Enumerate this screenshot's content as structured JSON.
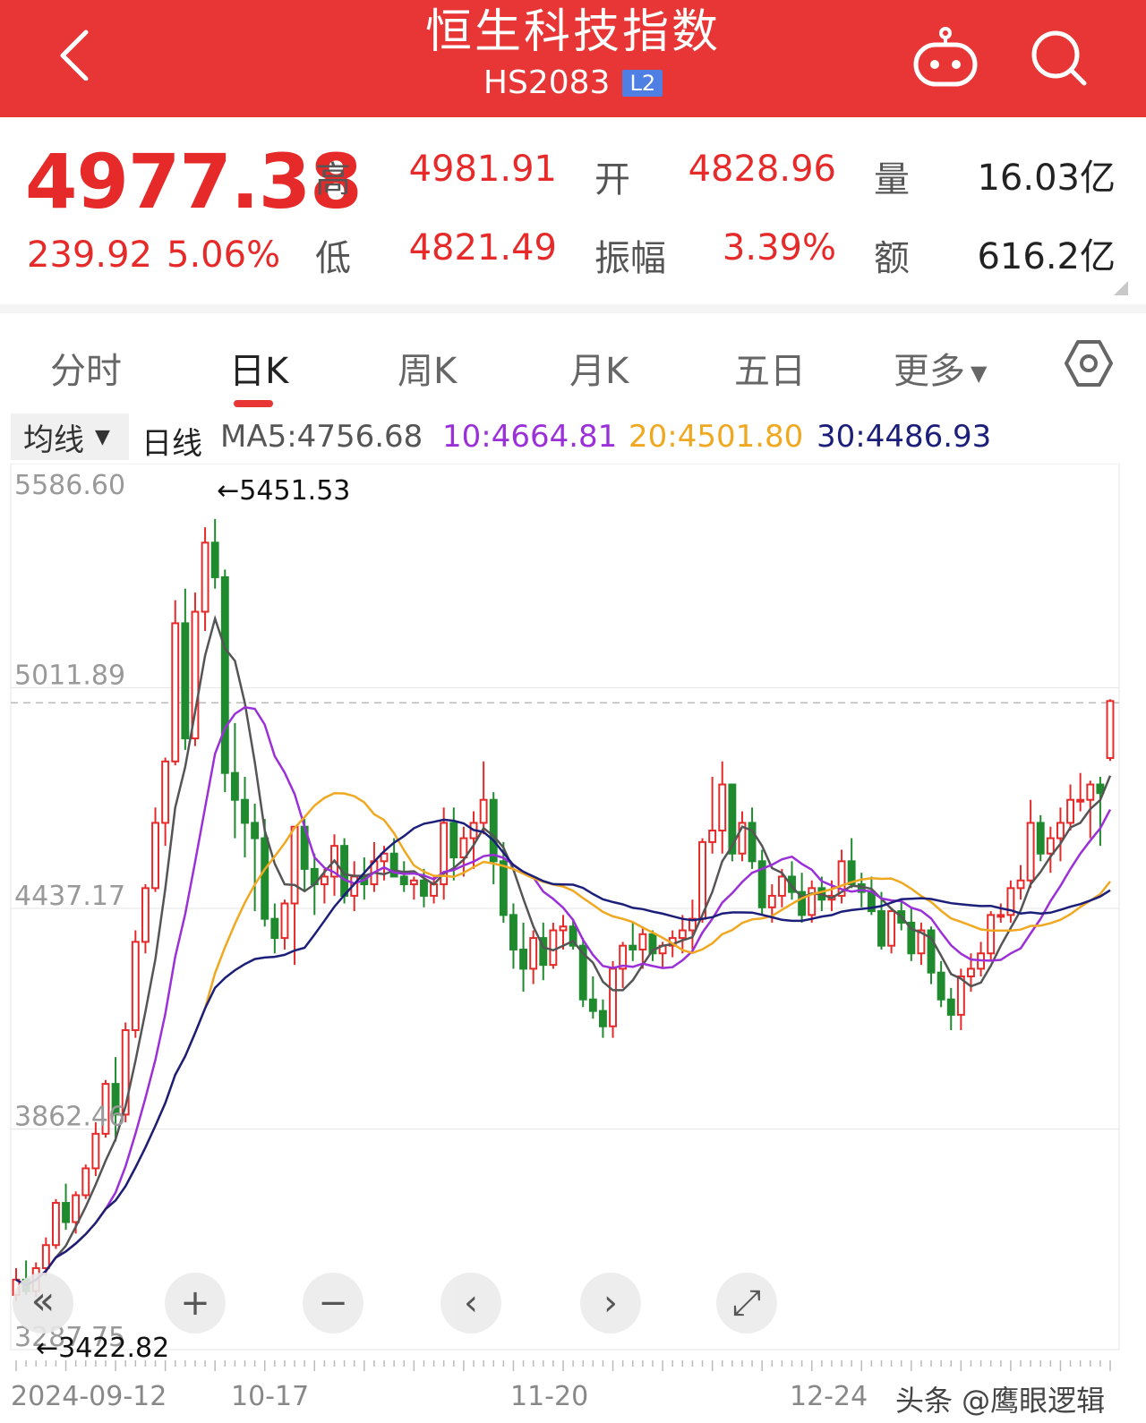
{
  "header": {
    "title": "恒生科技指数",
    "code": "HS2083",
    "level_badge": "L2"
  },
  "quote": {
    "price": "4977.38",
    "change": "239.92",
    "change_pct": "5.06%",
    "high_label": "高",
    "high": "4981.91",
    "open_label": "开",
    "open": "4828.96",
    "volume_label": "量",
    "volume": "16.03亿",
    "low_label": "低",
    "low": "4821.49",
    "amplitude_label": "振幅",
    "amplitude": "3.39%",
    "amount_label": "额",
    "amount": "616.2亿"
  },
  "tabs": [
    "分时",
    "日K",
    "周K",
    "月K",
    "五日",
    "更多"
  ],
  "active_tab": "日K",
  "ma_bar": {
    "selector": "均线",
    "period": "日线",
    "ma5": "MA5:4756.68",
    "ma10": "10:4664.81",
    "ma20": "20:4501.80",
    "ma30": "30:4486.93"
  },
  "colors": {
    "brand_red": "#e83535",
    "up": "#e62a2a",
    "down": "#1f8a2e",
    "ma5": "#555555",
    "ma10": "#9b30d9",
    "ma20": "#f0a820",
    "ma30": "#1c1f7a"
  },
  "chart_data": {
    "type": "candlestick",
    "y_tick_labels": [
      "5586.60",
      "5011.89",
      "4437.17",
      "3862.46",
      "3287.75"
    ],
    "x_tick_labels": [
      "2024-09-12",
      "10-17",
      "11-20",
      "12-24"
    ],
    "max_marker": "←5451.53",
    "min_marker": "←3422.82",
    "ylim": [
      3287.75,
      5586.6
    ],
    "last_close": 4977.38,
    "candles": [
      [
        3430,
        3500,
        3415,
        3470
      ],
      [
        3470,
        3520,
        3430,
        3440
      ],
      [
        3440,
        3515,
        3425,
        3500
      ],
      [
        3500,
        3580,
        3480,
        3560
      ],
      [
        3560,
        3680,
        3550,
        3670
      ],
      [
        3670,
        3720,
        3600,
        3620
      ],
      [
        3620,
        3700,
        3590,
        3690
      ],
      [
        3690,
        3770,
        3680,
        3760
      ],
      [
        3760,
        3880,
        3740,
        3850
      ],
      [
        3850,
        3990,
        3840,
        3980
      ],
      [
        3980,
        4050,
        3830,
        3900
      ],
      [
        3900,
        4140,
        3880,
        4120
      ],
      [
        4120,
        4380,
        4100,
        4350
      ],
      [
        4350,
        4500,
        4320,
        4490
      ],
      [
        4490,
        4700,
        4480,
        4660
      ],
      [
        4660,
        4830,
        4600,
        4820
      ],
      [
        4820,
        5240,
        4810,
        5180
      ],
      [
        5180,
        5270,
        4850,
        4880
      ],
      [
        4880,
        5260,
        4860,
        5210
      ],
      [
        5210,
        5430,
        5160,
        5390
      ],
      [
        5390,
        5451.53,
        5270,
        5300
      ],
      [
        5300,
        5320,
        4740,
        4790
      ],
      [
        4790,
        4920,
        4620,
        4720
      ],
      [
        4720,
        4780,
        4570,
        4660
      ],
      [
        4660,
        4710,
        4430,
        4620
      ],
      [
        4620,
        4670,
        4390,
        4410
      ],
      [
        4410,
        4450,
        4320,
        4360
      ],
      [
        4360,
        4460,
        4330,
        4450
      ],
      [
        4450,
        4650,
        4290,
        4650
      ],
      [
        4650,
        4670,
        4480,
        4540
      ],
      [
        4540,
        4580,
        4420,
        4500
      ],
      [
        4500,
        4540,
        4450,
        4520
      ],
      [
        4520,
        4630,
        4470,
        4600
      ],
      [
        4600,
        4620,
        4450,
        4470
      ],
      [
        4470,
        4560,
        4430,
        4520
      ],
      [
        4520,
        4570,
        4460,
        4500
      ],
      [
        4500,
        4610,
        4480,
        4560
      ],
      [
        4560,
        4600,
        4510,
        4580
      ],
      [
        4580,
        4620,
        4520,
        4520
      ],
      [
        4520,
        4560,
        4480,
        4500
      ],
      [
        4500,
        4520,
        4460,
        4510
      ],
      [
        4510,
        4540,
        4440,
        4470
      ],
      [
        4470,
        4520,
        4450,
        4500
      ],
      [
        4500,
        4700,
        4460,
        4660
      ],
      [
        4660,
        4700,
        4510,
        4570
      ],
      [
        4570,
        4650,
        4520,
        4620
      ],
      [
        4620,
        4690,
        4540,
        4660
      ],
      [
        4660,
        4820,
        4630,
        4720
      ],
      [
        4720,
        4740,
        4500,
        4560
      ],
      [
        4560,
        4610,
        4400,
        4420
      ],
      [
        4420,
        4450,
        4280,
        4330
      ],
      [
        4330,
        4400,
        4220,
        4280
      ],
      [
        4280,
        4380,
        4240,
        4360
      ],
      [
        4360,
        4400,
        4250,
        4290
      ],
      [
        4290,
        4400,
        4280,
        4380
      ],
      [
        4380,
        4420,
        4330,
        4390
      ],
      [
        4390,
        4410,
        4330,
        4340
      ],
      [
        4340,
        4360,
        4180,
        4200
      ],
      [
        4200,
        4260,
        4150,
        4170
      ],
      [
        4170,
        4200,
        4100,
        4130
      ],
      [
        4130,
        4300,
        4100,
        4280
      ],
      [
        4280,
        4350,
        4230,
        4340
      ],
      [
        4340,
        4400,
        4300,
        4330
      ],
      [
        4330,
        4390,
        4280,
        4370
      ],
      [
        4370,
        4380,
        4300,
        4320
      ],
      [
        4320,
        4350,
        4280,
        4340
      ],
      [
        4340,
        4380,
        4310,
        4360
      ],
      [
        4360,
        4420,
        4320,
        4380
      ],
      [
        4380,
        4460,
        4330,
        4410
      ],
      [
        4410,
        4620,
        4400,
        4610
      ],
      [
        4610,
        4780,
        4580,
        4640
      ],
      [
        4640,
        4820,
        4580,
        4760
      ],
      [
        4760,
        4760,
        4560,
        4580
      ],
      [
        4580,
        4690,
        4560,
        4660
      ],
      [
        4660,
        4700,
        4540,
        4560
      ],
      [
        4560,
        4590,
        4420,
        4440
      ],
      [
        4440,
        4500,
        4400,
        4470
      ],
      [
        4470,
        4540,
        4440,
        4520
      ],
      [
        4520,
        4560,
        4460,
        4480
      ],
      [
        4480,
        4530,
        4400,
        4420
      ],
      [
        4420,
        4510,
        4400,
        4490
      ],
      [
        4490,
        4520,
        4430,
        4460
      ],
      [
        4460,
        4510,
        4430,
        4470
      ],
      [
        4470,
        4590,
        4450,
        4560
      ],
      [
        4560,
        4620,
        4490,
        4500
      ],
      [
        4500,
        4530,
        4440,
        4480
      ],
      [
        4480,
        4520,
        4420,
        4430
      ],
      [
        4430,
        4480,
        4330,
        4340
      ],
      [
        4340,
        4440,
        4320,
        4430
      ],
      [
        4430,
        4460,
        4380,
        4400
      ],
      [
        4400,
        4440,
        4300,
        4320
      ],
      [
        4320,
        4400,
        4290,
        4380
      ],
      [
        4380,
        4390,
        4240,
        4270
      ],
      [
        4270,
        4300,
        4180,
        4200
      ],
      [
        4200,
        4230,
        4120,
        4160
      ],
      [
        4160,
        4280,
        4120,
        4260
      ],
      [
        4260,
        4320,
        4220,
        4280
      ],
      [
        4280,
        4350,
        4260,
        4320
      ],
      [
        4320,
        4430,
        4300,
        4420
      ],
      [
        4420,
        4450,
        4400,
        4420
      ],
      [
        4420,
        4510,
        4400,
        4490
      ],
      [
        4490,
        4550,
        4460,
        4510
      ],
      [
        4510,
        4720,
        4490,
        4660
      ],
      [
        4660,
        4680,
        4560,
        4580
      ],
      [
        4580,
        4650,
        4530,
        4620
      ],
      [
        4620,
        4700,
        4560,
        4660
      ],
      [
        4660,
        4760,
        4640,
        4720
      ],
      [
        4720,
        4790,
        4690,
        4720
      ],
      [
        4720,
        4770,
        4620,
        4760
      ],
      [
        4760,
        4780,
        4600,
        4737.46
      ],
      [
        4828.96,
        4981.91,
        4821.49,
        4977.38
      ]
    ],
    "ma5_last": 4756.68,
    "ma10_last": 4664.81,
    "ma20_last": 4501.8,
    "ma30_last": 4486.93
  },
  "chart_controls": [
    "«",
    "+",
    "−",
    "‹",
    "›",
    "⤢"
  ],
  "watermark": "头条 @鹰眼逻辑"
}
